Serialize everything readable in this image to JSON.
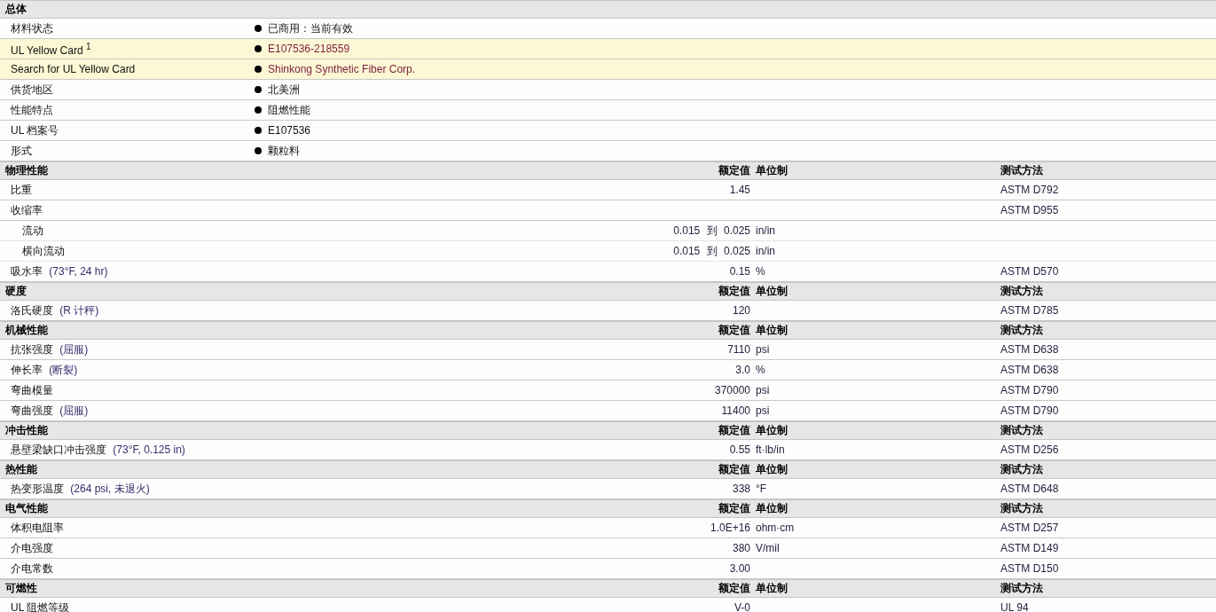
{
  "general": {
    "title": "总体",
    "rows": [
      {
        "label": "材料状态",
        "value": "已商用：当前有效",
        "highlighted": false,
        "link": false
      },
      {
        "label": "UL Yellow Card $^{1}$",
        "value": "E107536-218559",
        "highlighted": true,
        "link": true
      },
      {
        "label": "Search for UL Yellow Card",
        "value": "Shinkong Synthetic Fiber Corp.",
        "highlighted": true,
        "link": true
      },
      {
        "label": "供货地区",
        "value": "北美洲",
        "highlighted": false,
        "link": false
      },
      {
        "label": "性能特点",
        "value": "阻燃性能",
        "highlighted": false,
        "link": false
      },
      {
        "label": "UL 档案号",
        "value": "E107536",
        "highlighted": false,
        "link": false
      },
      {
        "label": "形式",
        "value": "颗粒料",
        "highlighted": false,
        "link": false
      }
    ]
  },
  "sections": [
    {
      "title": "物理性能",
      "value_header": "额定值",
      "unit_header": "单位制",
      "method_header": "测试方法",
      "rows": [
        {
          "label": "比重",
          "value": "1.45",
          "method": "ASTM D792"
        },
        {
          "label": "收缩率",
          "method": "ASTM D955",
          "children": [
            {
              "label": "流动",
              "value_low": "0.015",
              "range_word": "到",
              "value_high": "0.025",
              "unit": "in/in"
            },
            {
              "label": "横向流动",
              "value_low": "0.015",
              "range_word": "到",
              "value_high": "0.025",
              "unit": "in/in"
            }
          ]
        },
        {
          "label": "吸水率",
          "condition": "(73°F, 24 hr)",
          "value": "0.15",
          "unit": "%",
          "method": "ASTM D570"
        }
      ]
    },
    {
      "title": "硬度",
      "value_header": "额定值",
      "unit_header": "单位制",
      "method_header": "测试方法",
      "rows": [
        {
          "label": "洛氏硬度",
          "condition": "(R 计秤)",
          "value": "120",
          "method": "ASTM D785"
        }
      ]
    },
    {
      "title": "机械性能",
      "value_header": "额定值",
      "unit_header": "单位制",
      "method_header": "测试方法",
      "rows": [
        {
          "label": "抗张强度",
          "condition": "(屈服)",
          "value": "7110",
          "unit": "psi",
          "method": "ASTM D638"
        },
        {
          "label": "伸长率",
          "condition": "(断裂)",
          "value": "3.0",
          "unit": "%",
          "method": "ASTM D638"
        },
        {
          "label": "弯曲模量",
          "value": "370000",
          "unit": "psi",
          "method": "ASTM D790"
        },
        {
          "label": "弯曲强度",
          "condition": "(屈服)",
          "value": "11400",
          "unit": "psi",
          "method": "ASTM D790"
        }
      ]
    },
    {
      "title": "冲击性能",
      "value_header": "额定值",
      "unit_header": "单位制",
      "method_header": "测试方法",
      "rows": [
        {
          "label": "悬壁梁缺口冲击强度",
          "condition": "(73°F, 0.125 in)",
          "value": "0.55",
          "unit": "ft·lb/in",
          "method": "ASTM D256"
        }
      ]
    },
    {
      "title": "热性能",
      "value_header": "额定值",
      "unit_header": "单位制",
      "method_header": "测试方法",
      "rows": [
        {
          "label": "热变形温度",
          "condition": "(264 psi, 未退火)",
          "value": "338",
          "unit": "°F",
          "method": "ASTM D648"
        }
      ]
    },
    {
      "title": "电气性能",
      "value_header": "额定值",
      "unit_header": "单位制",
      "method_header": "测试方法",
      "rows": [
        {
          "label": "体积电阻率",
          "value": "1.0E+16",
          "unit": "ohm·cm",
          "method": "ASTM D257"
        },
        {
          "label": "介电强度",
          "value": "380",
          "unit": "V/mil",
          "method": "ASTM D149"
        },
        {
          "label": "介电常数",
          "value": "3.00",
          "method": "ASTM D150"
        }
      ]
    },
    {
      "title": "可燃性",
      "value_header": "额定值",
      "unit_header": "单位制",
      "method_header": "测试方法",
      "rows": [
        {
          "label": "UL 阻燃等级",
          "value": "V-0",
          "method": "UL 94"
        }
      ]
    }
  ]
}
